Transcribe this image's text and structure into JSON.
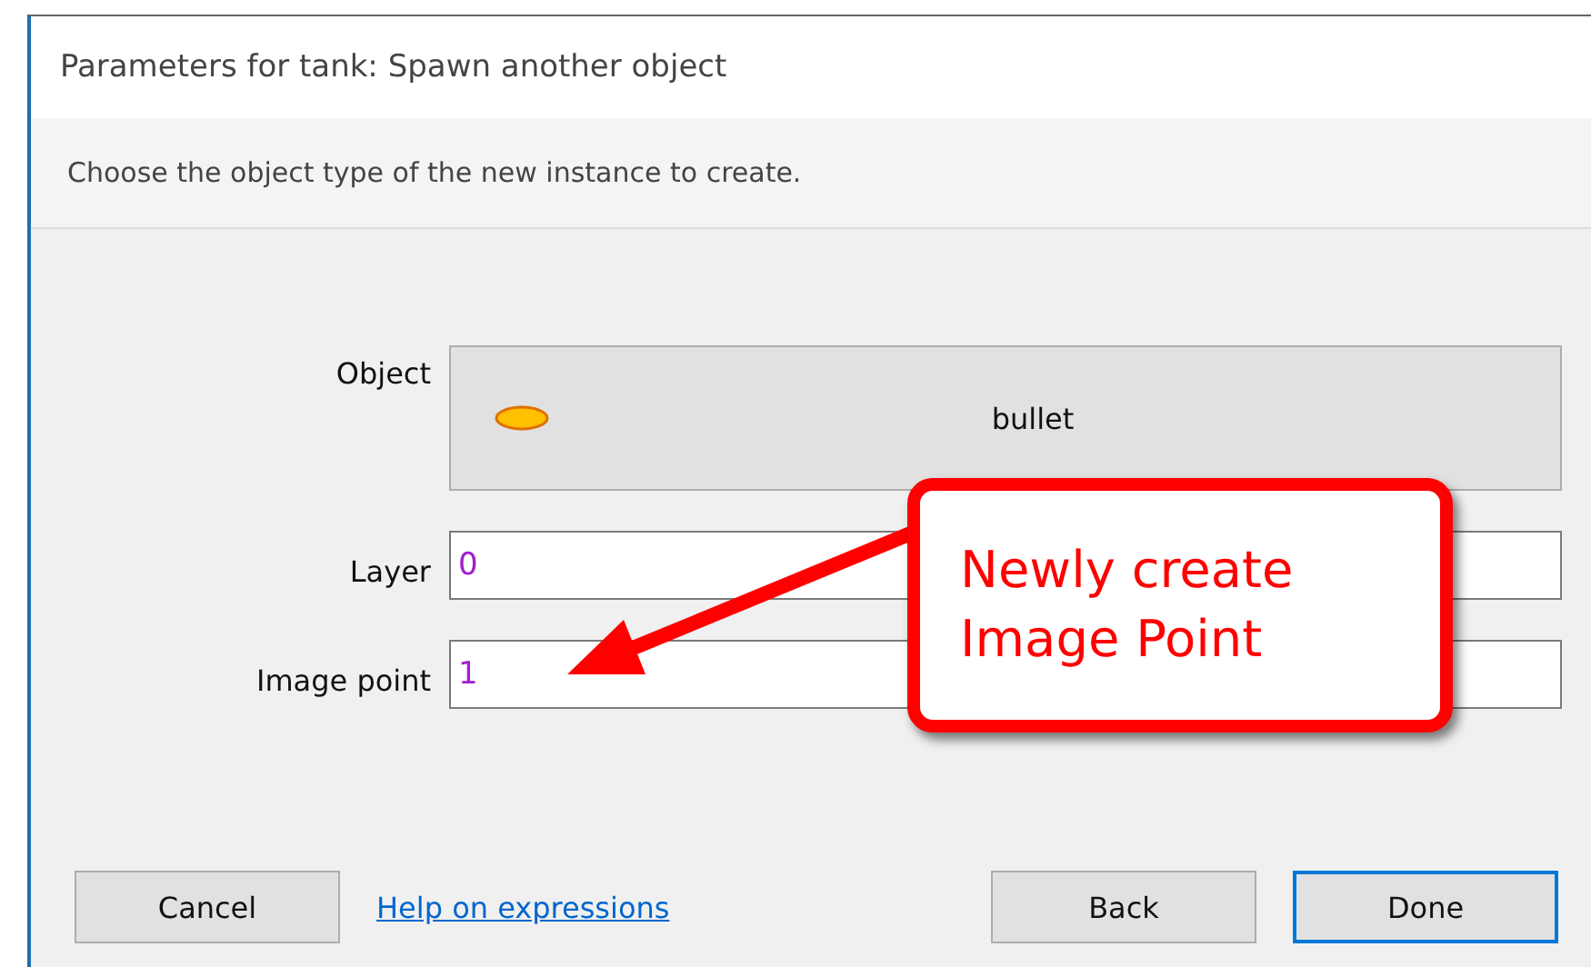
{
  "window": {
    "title": "Parameters for tank: Spawn another object"
  },
  "instruction": "Choose the object type of the new instance to create.",
  "fields": [
    {
      "kind": "object",
      "label": "Object",
      "value": "bullet"
    },
    {
      "kind": "text",
      "label": "Layer",
      "value": "0"
    },
    {
      "kind": "text",
      "label": "Image point",
      "value": "1"
    }
  ],
  "callout": {
    "lines": [
      "Newly create",
      "Image Point"
    ]
  },
  "buttons": [
    {
      "label": "Cancel",
      "focused": false
    },
    {
      "label": "Back",
      "focused": false
    },
    {
      "label": "Done",
      "focused": true
    }
  ],
  "help_link": "Help on expressions"
}
